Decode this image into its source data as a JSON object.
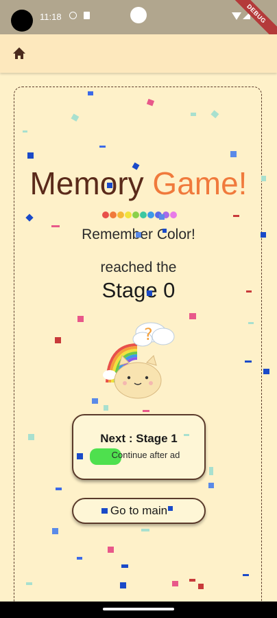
{
  "status_bar": {
    "time": "11:18",
    "debug_label": "DEBUG"
  },
  "app_bar": {
    "home_icon": "home-icon"
  },
  "game": {
    "title_part1": "Memory",
    "title_part2": "Game!",
    "color_dots": [
      "#e8504a",
      "#f07a3c",
      "#f5b83a",
      "#f2e23c",
      "#8ad04a",
      "#3cc8a0",
      "#3c9ae8",
      "#5a6ae8",
      "#a86ae8",
      "#e87ae8"
    ],
    "subtitle": "Remember Color!",
    "reached_text": "reached the",
    "stage_text": "Stage 0"
  },
  "buttons": {
    "next_label": "Next : Stage 1",
    "ad_label": "Continue after ad",
    "main_label": "Go to main"
  },
  "colors": {
    "background": "#fef1c9",
    "accent_orange": "#f07a3c",
    "border_brown": "#5a3a2a",
    "ad_green": "#4ee04e"
  }
}
